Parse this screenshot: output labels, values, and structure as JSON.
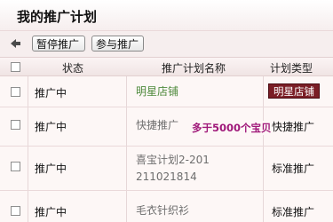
{
  "header": {
    "title": "我的推广计划"
  },
  "toolbar": {
    "back_icon": "back-arrow-icon",
    "pause_label": "暂停推广",
    "join_label": "参与推广"
  },
  "table": {
    "columns": [
      "状态",
      "推广计划名称",
      "计划类型"
    ],
    "rows": [
      {
        "status": "推广中",
        "name": "明星店铺",
        "name_color": "#4e8a3c",
        "type": "明星店铺"
      },
      {
        "status": "推广中",
        "name": "快捷推广",
        "name_color": "#6e6e6e",
        "type": "快捷推广"
      },
      {
        "status": "推广中",
        "name": "喜宝计划2-201211021814",
        "name_color": "#6e6e6e",
        "type": "标准推广"
      },
      {
        "status": "推广中",
        "name": "毛衣针织衫",
        "name_color": "#6e6e6e",
        "type": "标准推广"
      }
    ]
  },
  "tooltip": {
    "text": "多于5000个宝贝"
  },
  "colors": {
    "star_tag_bg": "#7a1d25",
    "tooltip_text": "#a0197a"
  }
}
